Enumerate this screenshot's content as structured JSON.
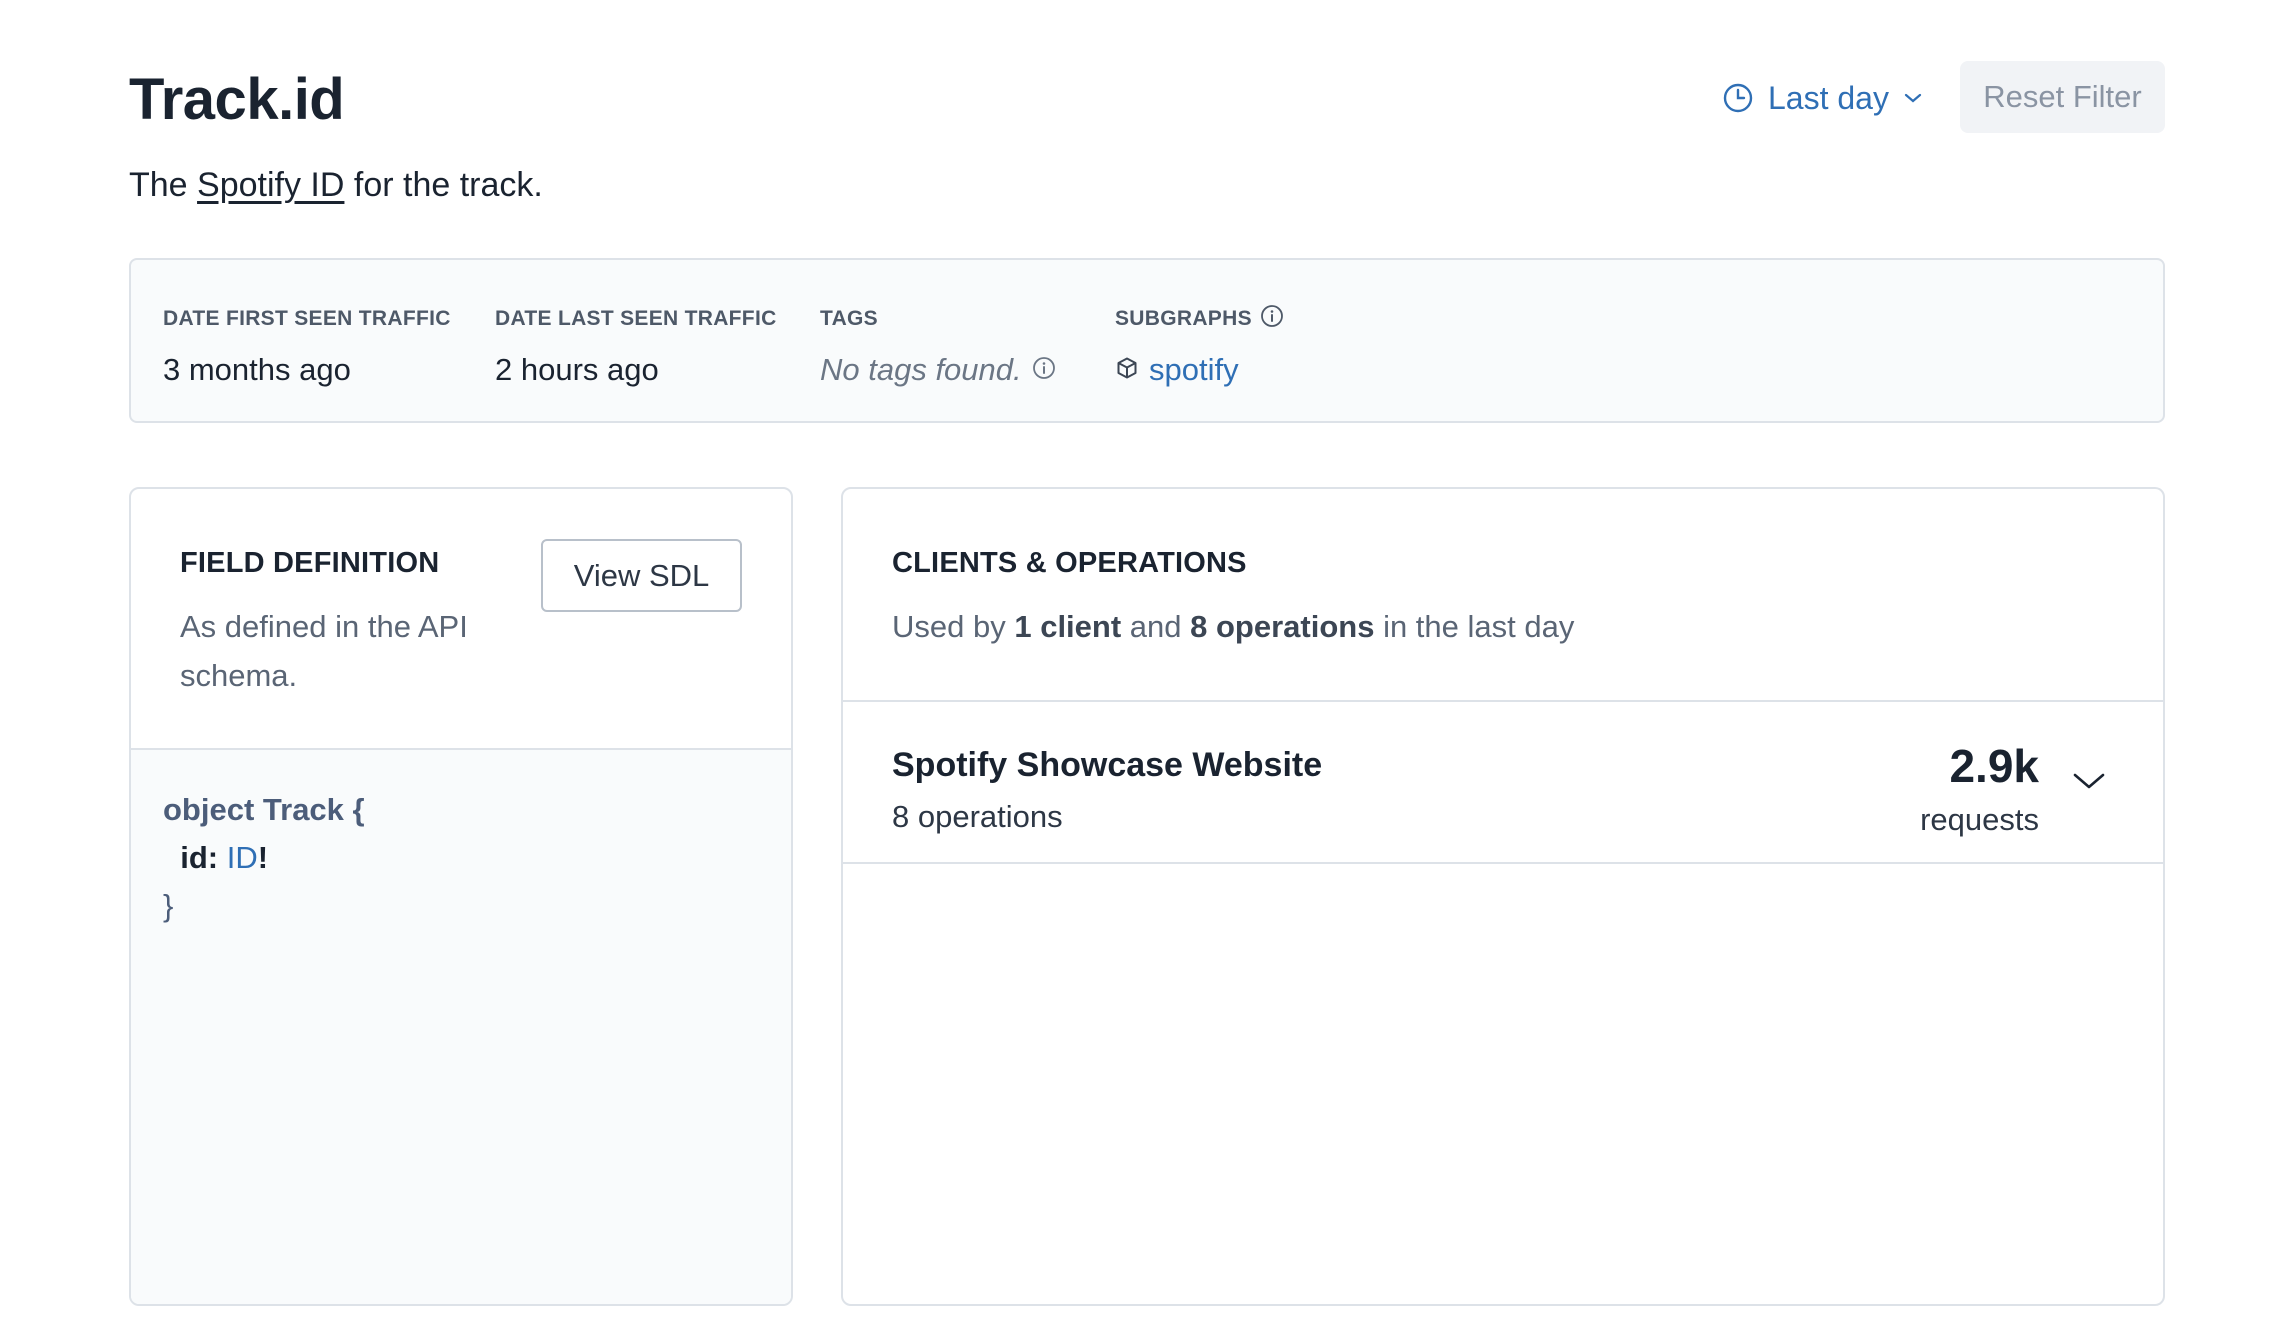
{
  "header": {
    "type_name": "Track.",
    "field_name": "id",
    "description_prefix": "The ",
    "description_link": "Spotify ID",
    "description_suffix": " for the track.",
    "time_range_label": "Last day",
    "reset_filter_label": "Reset Filter"
  },
  "metadata": {
    "first_seen_label": "DATE FIRST SEEN TRAFFIC",
    "first_seen_value": "3 months ago",
    "last_seen_label": "DATE LAST SEEN TRAFFIC",
    "last_seen_value": "2 hours ago",
    "tags_label": "TAGS",
    "tags_value": "No tags found.",
    "subgraphs_label": "SUBGRAPHS",
    "subgraphs_value": "spotify"
  },
  "field_definition": {
    "title": "FIELD DEFINITION",
    "subtitle_line1": "As defined in the API",
    "subtitle_line2": "schema.",
    "view_sdl_label": "View SDL",
    "code": {
      "line1_keyword": "object Track {",
      "line2_field": "id:",
      "line2_type": "ID",
      "line2_bang": "!",
      "line3": "}"
    }
  },
  "clients": {
    "title": "CLIENTS & OPERATIONS",
    "summary_prefix": "Used by ",
    "summary_clients": "1 client",
    "summary_and": " and ",
    "summary_operations": "8 operations",
    "summary_suffix": " in the last day",
    "rows": [
      {
        "name": "Spotify Showcase Website",
        "operations": "8 operations",
        "requests": "2.9k",
        "requests_label": "requests"
      }
    ]
  },
  "colors": {
    "accent": "#2f6fb5",
    "border": "#dde2e8",
    "panel_bg": "#f9fbfc"
  }
}
